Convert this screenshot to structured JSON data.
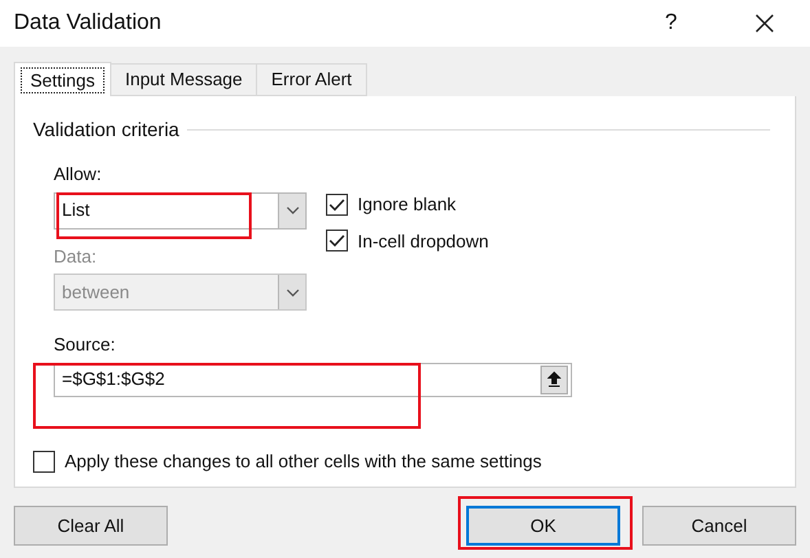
{
  "window": {
    "title": "Data Validation",
    "help": "?"
  },
  "tabs": [
    {
      "label": "Settings",
      "selected": true
    },
    {
      "label": "Input Message",
      "selected": false
    },
    {
      "label": "Error Alert",
      "selected": false
    }
  ],
  "group": {
    "title": "Validation criteria"
  },
  "fields": [
    {
      "kind": "combo",
      "label": "Allow:",
      "value": "List",
      "disabled": false,
      "highlighted": true
    },
    {
      "kind": "combo",
      "label": "Data:",
      "value": "between",
      "disabled": true,
      "highlighted": false
    },
    {
      "kind": "range",
      "label": "Source:",
      "value": "=$G$1:$G$2",
      "disabled": false,
      "highlighted": true
    }
  ],
  "options": [
    {
      "label": "Ignore blank",
      "checked": true
    },
    {
      "label": "In-cell dropdown",
      "checked": true
    }
  ],
  "apply": {
    "label": "Apply these changes to all other cells with the same settings",
    "checked": false
  },
  "buttons": [
    {
      "label": "Clear All",
      "default": false,
      "highlighted": false
    },
    {
      "label": "OK",
      "default": true,
      "highlighted": true
    },
    {
      "label": "Cancel",
      "default": false,
      "highlighted": false
    }
  ]
}
